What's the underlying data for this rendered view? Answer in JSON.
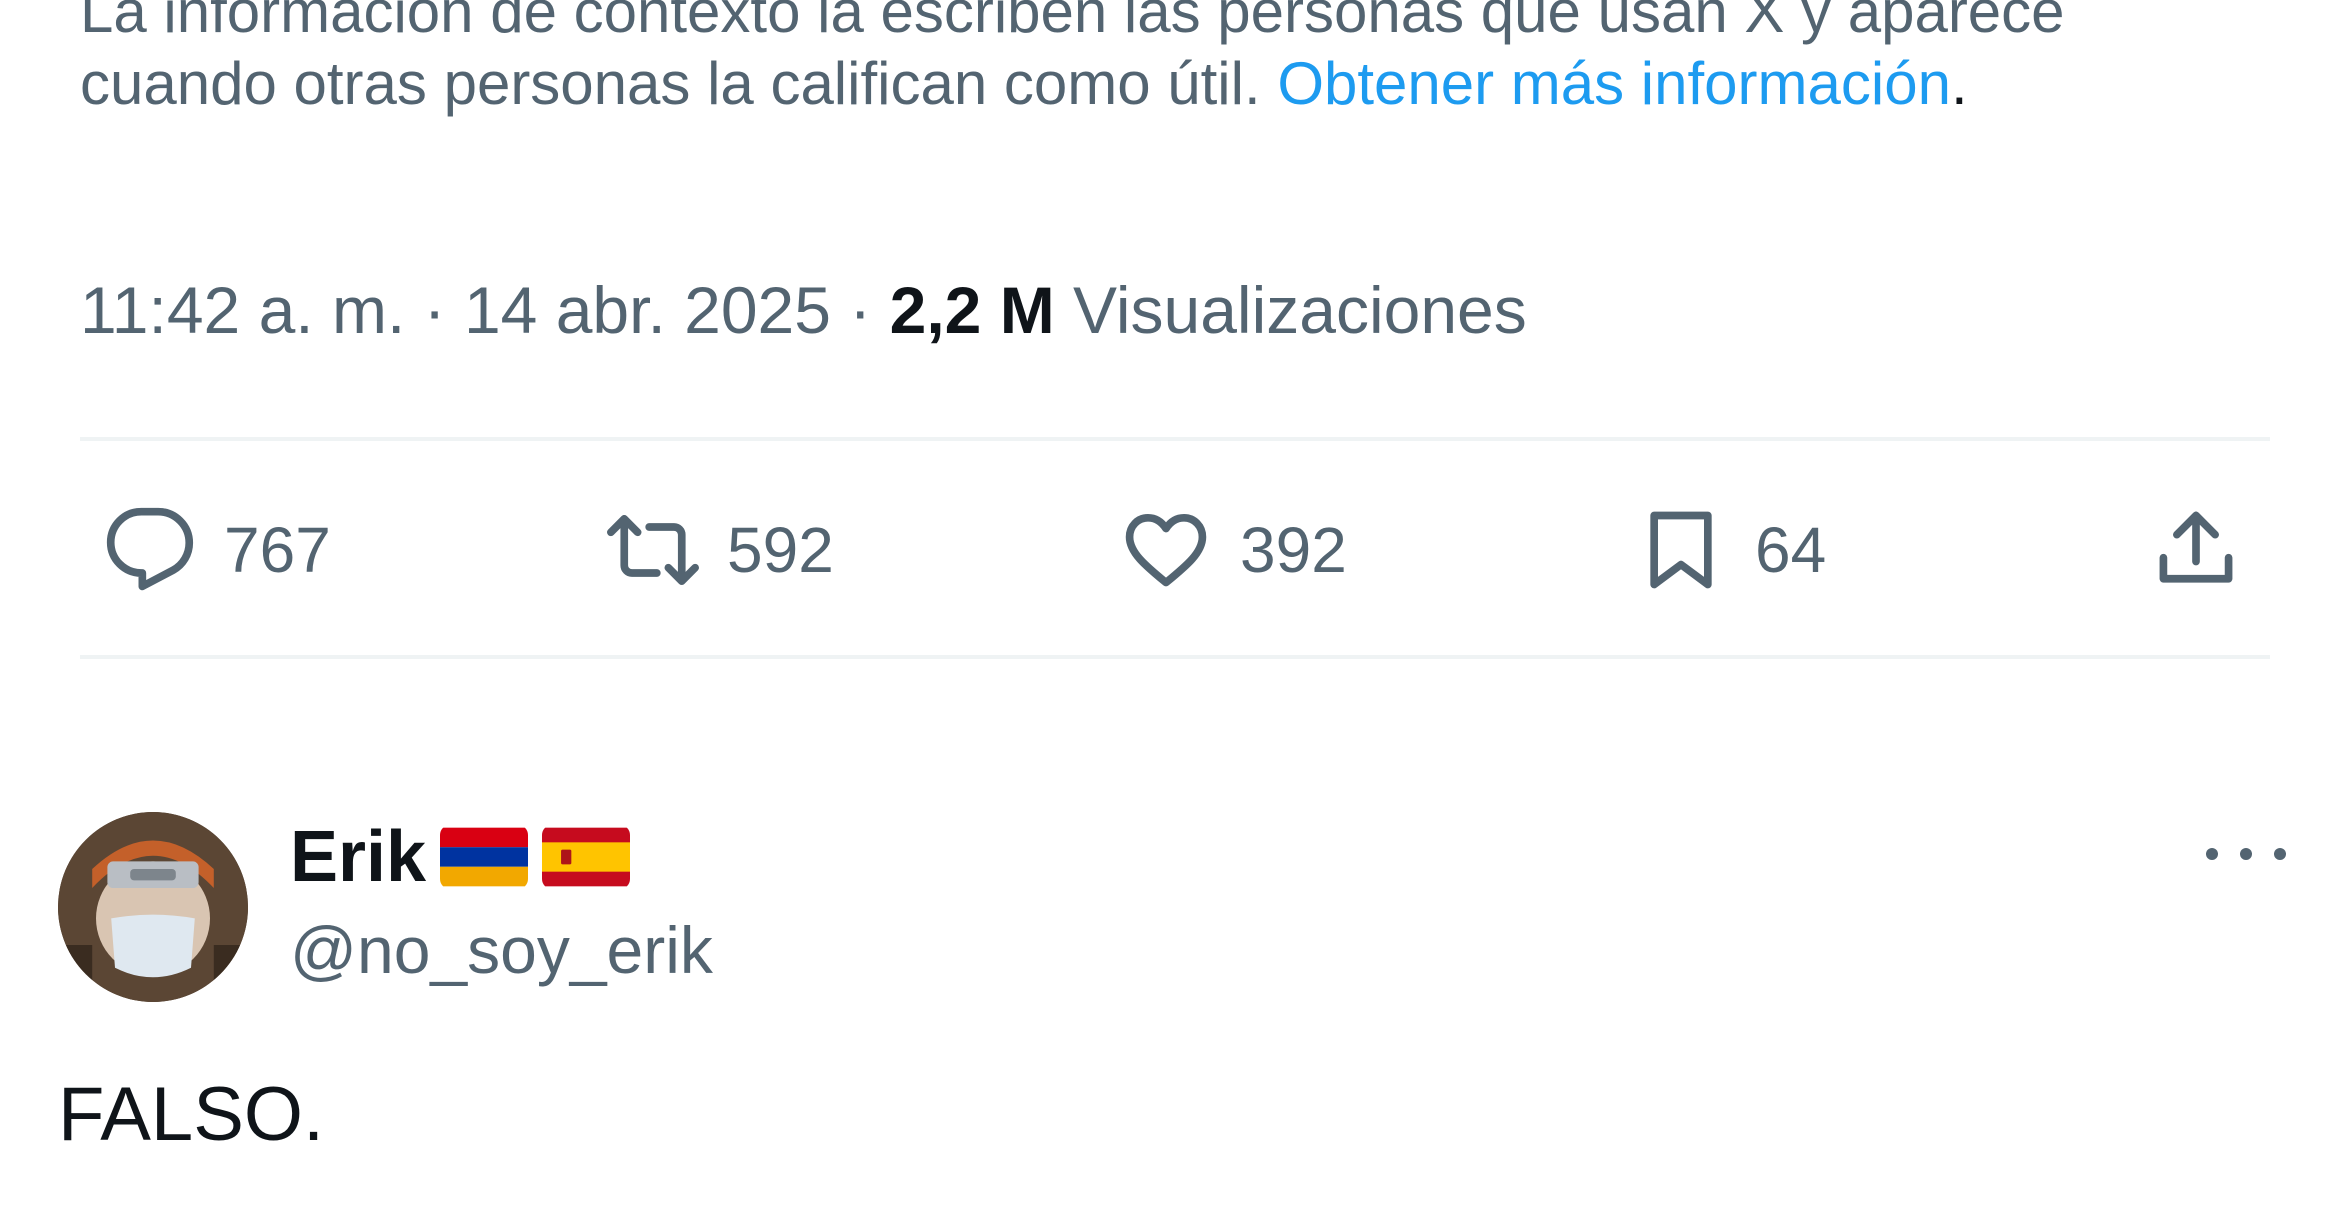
{
  "community_note": {
    "line1": "La información de contexto la escriben las personas que usan X y aparece",
    "line2": "cuando otras personas la califican como útil.",
    "link": "Obtener más información",
    "period": "."
  },
  "tweet_meta": {
    "time": "11:42 a. m.",
    "sep1": " · ",
    "date": "14 abr. 2025",
    "sep2": " · ",
    "views_count": "2,2 M",
    "views_label": " Visualizaciones"
  },
  "actions": {
    "reply_count": "767",
    "retweet_count": "592",
    "like_count": "392",
    "bookmark_count": "64"
  },
  "icons": {
    "reply": "reply-icon",
    "retweet": "retweet-icon",
    "like": "heart-icon",
    "bookmark": "bookmark-icon",
    "share": "share-icon",
    "more": "more-dots-icon"
  },
  "reply": {
    "display_name": "Erik",
    "flags": [
      "armenia-flag",
      "spain-flag"
    ],
    "handle": "@no_soy_erik",
    "text": "FALSO."
  },
  "colors": {
    "link": "#1d9bf0",
    "secondary_text": "#536471",
    "primary_text": "#0f1419",
    "divider": "#eff3f4"
  }
}
